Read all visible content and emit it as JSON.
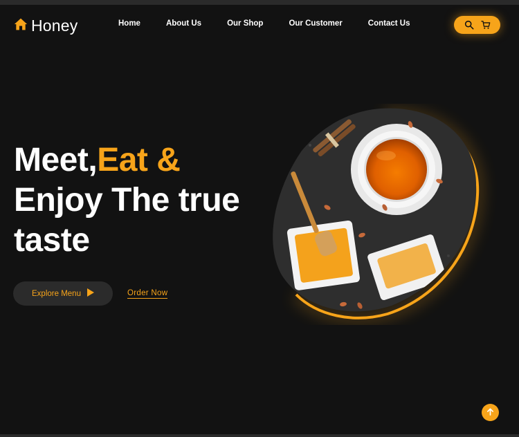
{
  "header": {
    "logo_text": "Honey",
    "logo_icon": "home-icon",
    "nav": [
      {
        "label": "Home"
      },
      {
        "label": "About Us"
      },
      {
        "label": "Our Shop"
      },
      {
        "label": "Our Customer"
      },
      {
        "label": "Contact Us"
      }
    ],
    "actions": [
      "search-icon",
      "cart-icon"
    ]
  },
  "hero": {
    "title_part1": "Meet,",
    "title_highlight": "Eat &",
    "title_line2": "Enjoy The true",
    "title_line3": "taste",
    "explore_label": "Explore Menu",
    "order_label": "Order Now"
  },
  "colors": {
    "accent": "#f7a41a",
    "background": "#121212",
    "button_dark": "#2b2b2b"
  },
  "scroll_top_icon": "arrow-up-icon"
}
